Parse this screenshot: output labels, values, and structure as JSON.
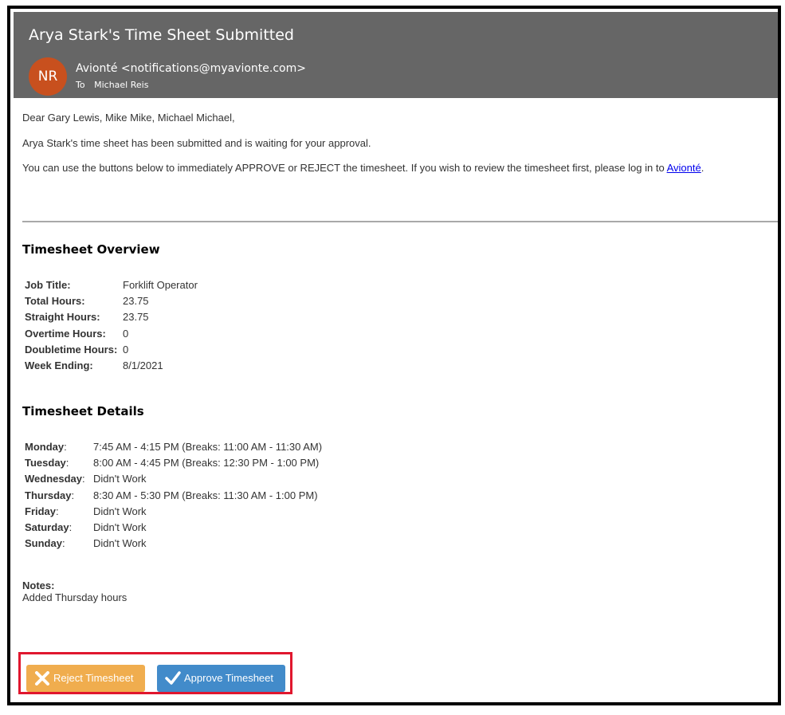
{
  "email": {
    "subject": "Arya Stark's Time Sheet Submitted",
    "avatar_initials": "NR",
    "avatar_color": "#c8501e",
    "from": "Avionté <notifications@myavionte.com>",
    "to_label": "To",
    "to_name": "Michael Reis"
  },
  "body": {
    "greeting": "Dear Gary Lewis, Mike Mike, Michael Michael,",
    "status_text": "Arya Stark's time sheet has been submitted and is waiting for your approval.",
    "instructions_text": "You can use the buttons below to immediately APPROVE or REJECT the timesheet. If you wish to review the timesheet first, please log in to ",
    "login_link": "Avionté",
    "instructions_end": "."
  },
  "overview": {
    "title": "Timesheet Overview",
    "rows": [
      {
        "label": "Job Title:",
        "value": "Forklift Operator"
      },
      {
        "label": "Total Hours:",
        "value": "23.75"
      },
      {
        "label": "Straight Hours:",
        "value": "23.75"
      },
      {
        "label": "Overtime Hours:",
        "value": "0"
      },
      {
        "label": "Doubletime Hours:",
        "value": "0"
      },
      {
        "label": "Week Ending:",
        "value": "8/1/2021"
      }
    ]
  },
  "details": {
    "title": "Timesheet Details",
    "days": [
      {
        "day": "Monday",
        "value": "7:45 AM - 4:15 PM (Breaks: 11:00 AM - 11:30 AM)"
      },
      {
        "day": "Tuesday",
        "value": "8:00 AM - 4:45 PM (Breaks: 12:30 PM - 1:00 PM)"
      },
      {
        "day": "Wednesday",
        "value": "Didn't Work"
      },
      {
        "day": "Thursday",
        "value": "8:30 AM - 5:30 PM (Breaks: 11:30 AM - 1:00 PM)"
      },
      {
        "day": "Friday",
        "value": "Didn't Work"
      },
      {
        "day": "Saturday",
        "value": "Didn't Work"
      },
      {
        "day": "Sunday",
        "value": "Didn't Work"
      }
    ],
    "colon": ":"
  },
  "notes": {
    "label": "Notes:",
    "text": "Added Thursday hours"
  },
  "actions": {
    "reject_label": "Reject Timesheet",
    "reject_icon": "x-icon",
    "reject_color": "#f0ad4e",
    "approve_label": "Approve Timesheet",
    "approve_icon": "checkmark-icon",
    "approve_color": "#428bca",
    "highlight_color": "#e0172e"
  }
}
